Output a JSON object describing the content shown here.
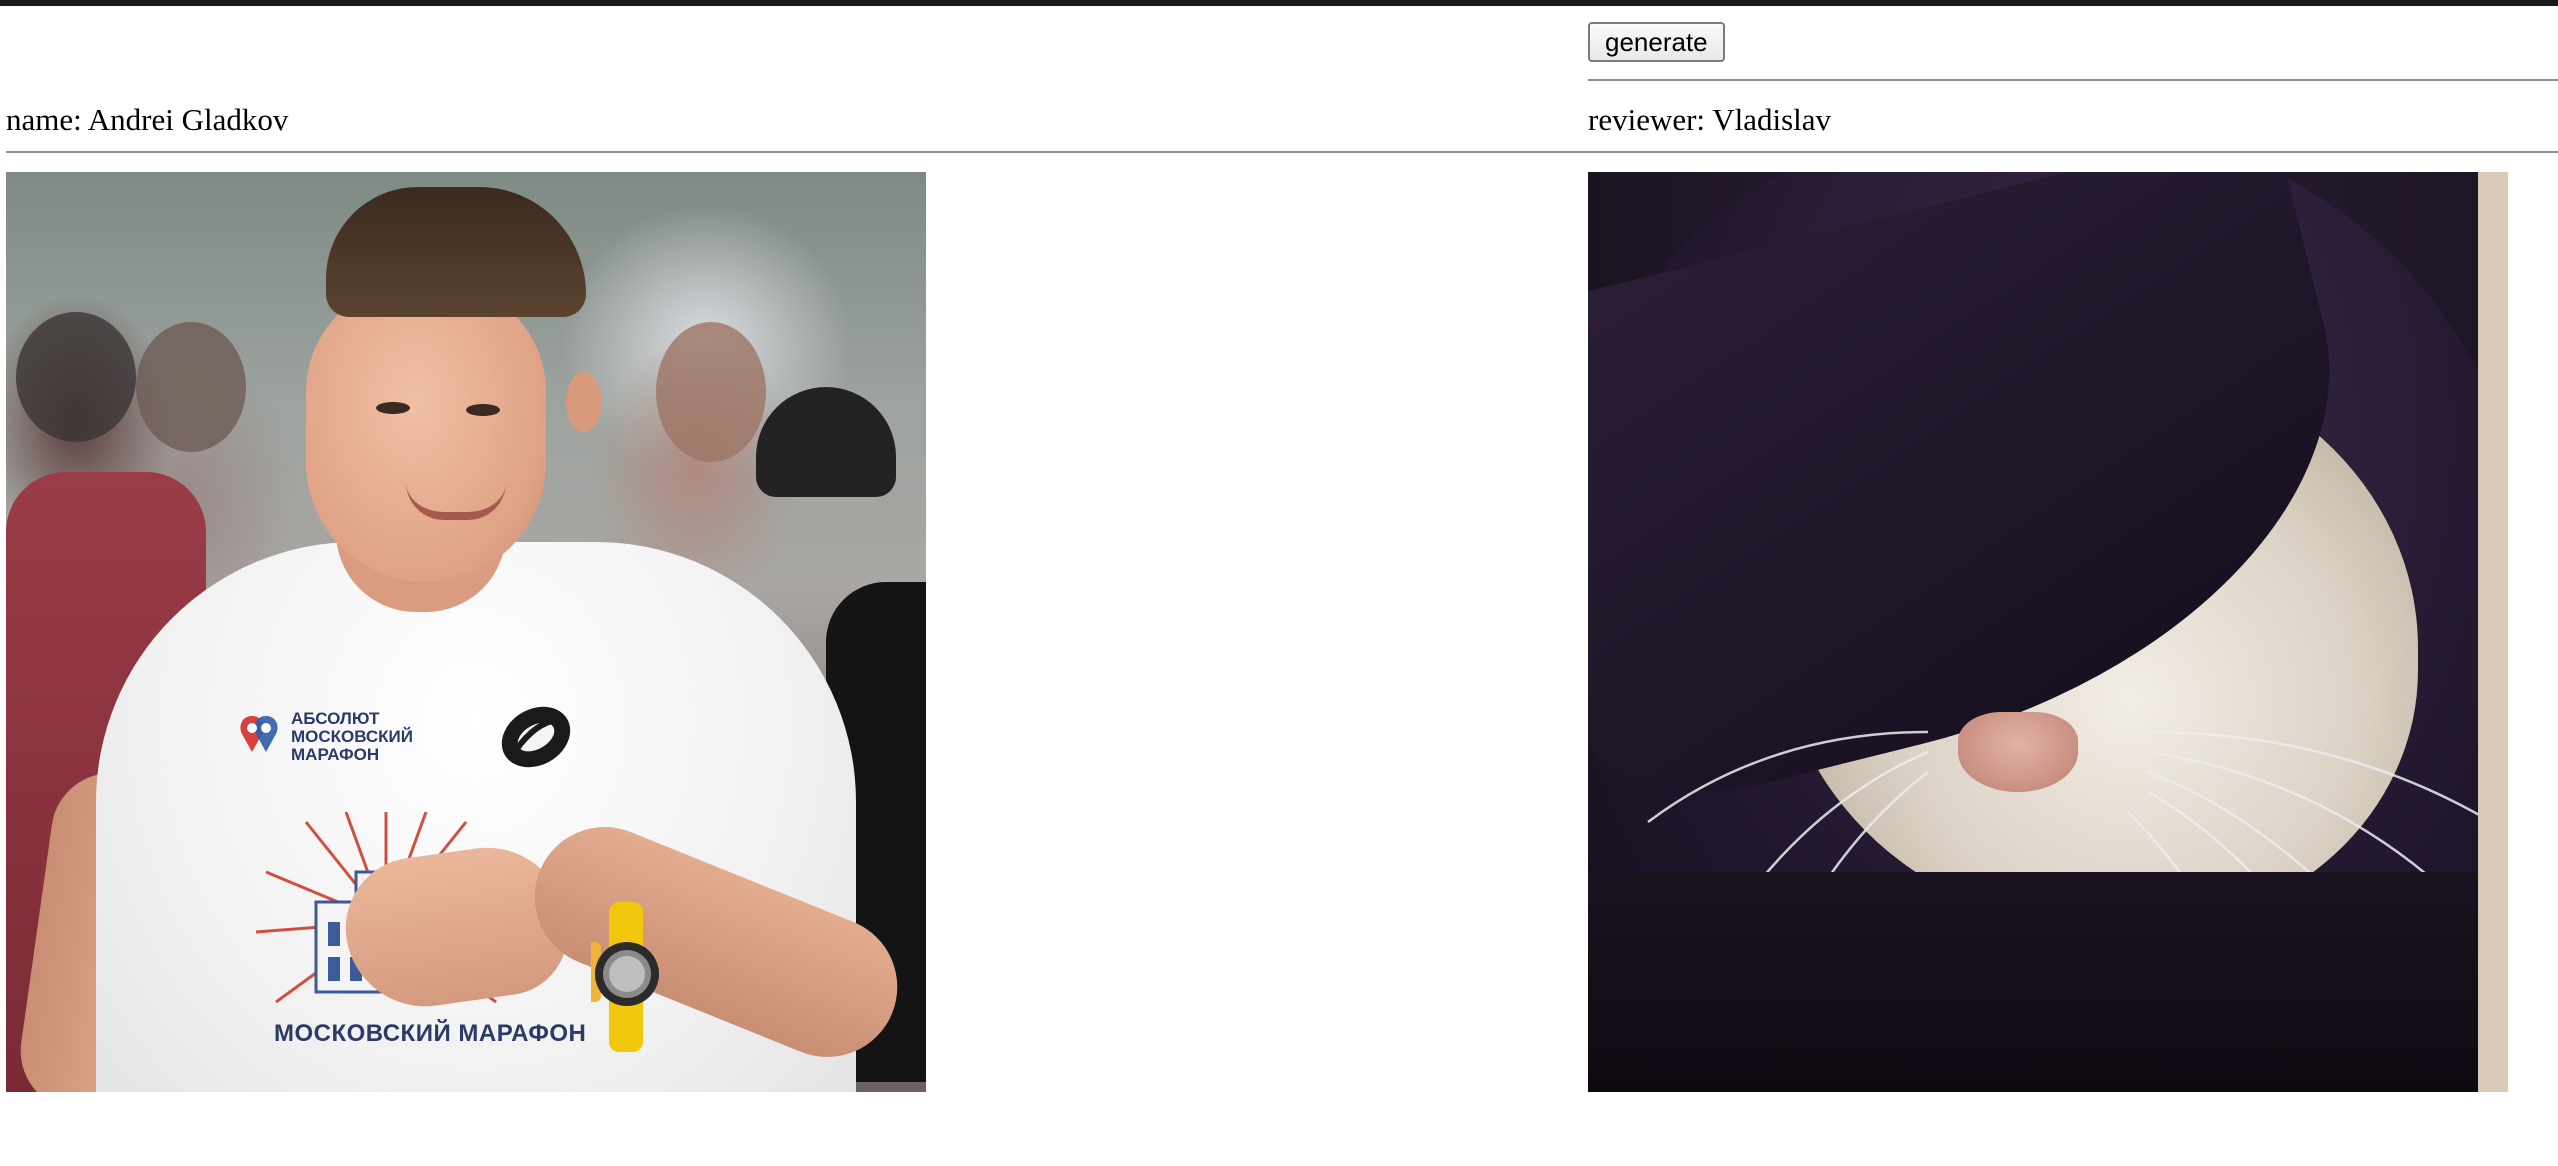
{
  "left": {
    "name_label": "name: Andrei Gladkov",
    "photo": {
      "logo_text": "АБСОЛЮТ\nМОСКОВСКИЙ\nМАРАФОН",
      "print_text": "МОСКОВСКИЙ МАРАФОН"
    }
  },
  "right": {
    "generate_label": "generate",
    "reviewer_label": "reviewer: Vladislav"
  },
  "colors": {
    "top_bar": "#1b1b1b",
    "divider": "#8c8c8c",
    "print_navy": "#2b3a66"
  }
}
